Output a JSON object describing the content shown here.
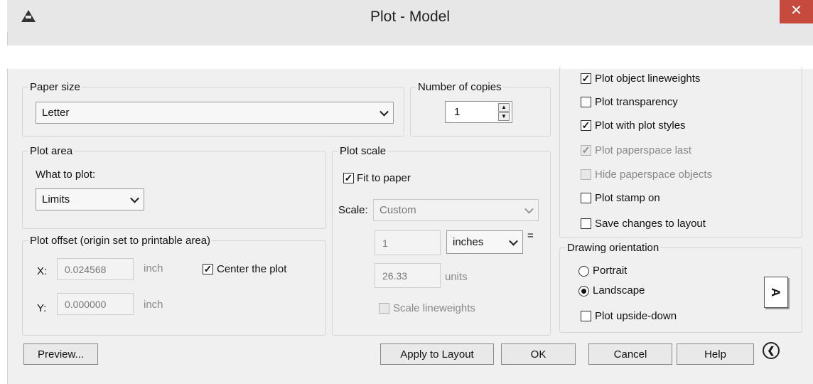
{
  "window": {
    "title": "Plot - Model",
    "close_glyph": "✕"
  },
  "paper_size": {
    "legend": "Paper size",
    "selected": "Letter"
  },
  "copies": {
    "legend": "Number of copies",
    "value": "1"
  },
  "plot_area": {
    "legend": "Plot area",
    "what_label": "What to plot:",
    "selected": "Limits"
  },
  "plot_offset": {
    "legend": "Plot offset (origin set to printable area)",
    "x_label": "X:",
    "x_value": "0.024568",
    "x_unit": "inch",
    "y_label": "Y:",
    "y_value": "0.000000",
    "y_unit": "inch",
    "center_label": "Center the plot",
    "center_checked": true
  },
  "plot_scale": {
    "legend": "Plot scale",
    "fit_label": "Fit to paper",
    "fit_checked": true,
    "scale_label": "Scale:",
    "scale_selected": "Custom",
    "value1": "1",
    "unit_selected": "inches",
    "equals": "=",
    "value2": "26.33",
    "units_label": "units",
    "lineweights_label": "Scale lineweights",
    "lineweights_checked": false
  },
  "plot_options": [
    {
      "label": "Plot object lineweights",
      "checked": true,
      "enabled": true
    },
    {
      "label": "Plot transparency",
      "checked": false,
      "enabled": true
    },
    {
      "label": "Plot with plot styles",
      "checked": true,
      "enabled": true
    },
    {
      "label": "Plot paperspace last",
      "checked": true,
      "enabled": false
    },
    {
      "label": "Hide paperspace objects",
      "checked": false,
      "enabled": false
    },
    {
      "label": "Plot stamp on",
      "checked": false,
      "enabled": true
    },
    {
      "label": "Save changes to layout",
      "checked": false,
      "enabled": true
    }
  ],
  "orientation": {
    "legend": "Drawing orientation",
    "portrait": "Portrait",
    "landscape": "Landscape",
    "selected": "Landscape",
    "upside_down": "Plot upside-down",
    "upside_down_checked": false,
    "preview_glyph": "A"
  },
  "buttons": {
    "preview": "Preview...",
    "apply": "Apply to Layout",
    "ok": "OK",
    "cancel": "Cancel",
    "help": "Help",
    "collapse_glyph": "❮"
  },
  "colors": {
    "close_button": "#c74a3f",
    "dialog_bg": "#f0f0f0",
    "titlebar_bg": "#e7e7e7"
  }
}
